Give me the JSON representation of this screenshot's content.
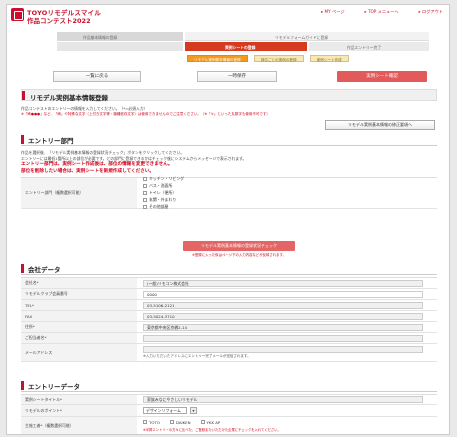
{
  "header": {
    "logo_line1": "TOYOリモデルスマイル",
    "logo_line2": "作品コンテスト2022",
    "nav": [
      "MY ページ",
      "TOP メニューへ",
      "ログアウト"
    ]
  },
  "steps": {
    "top_left": "作品基本情報の登録",
    "top_right": "リモデルフォームガイドに登録",
    "mid": [
      "",
      "実例シートの登録",
      "作品エントリー完了"
    ],
    "sub": [
      "リモデル実例基本情報の登録",
      "部位ごとの実例の登録",
      "実例シート作成"
    ],
    "sub_active": 0
  },
  "actions": {
    "back": "一覧に戻る",
    "save": "一時保存",
    "confirm": "実例シート確認"
  },
  "section1": {
    "title": "リモデル実例基本情報登録",
    "desc": "作品コンテストのエントリーの情報を入力してください。（*=必須入力）",
    "note": "※「㈱●●●」など、「㈱」や特殊な文字（上付き文字等・機種依存文字）は使用できませんのでご注意ください。（※「①」といった丸数字も使用不可です）",
    "rules_button": "リモデル実例基本情報の修正要項へ"
  },
  "section2": {
    "title": "エントリー部門",
    "desc1": "作品を選択後、「リモデル実例基本情報の登録状況チェック」ボタンをクリックしてください。",
    "desc2": "エントリーには最低1箇所以上の部位が必要です。どの部門に登録できるかはチェック後にシステムからメッセージで表示されます。",
    "warn1": "エントリー部門は、実例シート作成後は、部位の情報を変更できません。",
    "warn2": "部位を削除したい場合は、実例シートを新規作成してください。",
    "row_label": "エントリー部門（複数選択可能）",
    "options": [
      "キッチン・リビング",
      "バス・洗面所",
      "トイレ（便所）",
      "玄関・外まわり",
      "その他部屋"
    ]
  },
  "check_button": "リモデル実例基本情報の登録状況チェック",
  "check_note": "※登録に入った後はページ下の入力内容などが反映されます。",
  "section3": {
    "title": "会社データ",
    "rows": [
      {
        "label": "会社名*",
        "value": "(ー般)リモコン株式会社"
      },
      {
        "label": "リモデルクラブ会員番号",
        "value": "0000"
      },
      {
        "label": "TEL*",
        "value": "03-5106-2121"
      },
      {
        "label": "FAX",
        "value": "03-5024-3710"
      },
      {
        "label": "住所*",
        "value": "東京都中央区京橋2-14"
      },
      {
        "label": "ご担当者名*",
        "value": ""
      },
      {
        "label": "メールアドレス",
        "value": "",
        "note": "※入力いただいたアドレスにエントリー完了メールが送信されます。"
      }
    ]
  },
  "section4": {
    "title": "エントリーデータ",
    "rows": [
      {
        "label": "実例シートタイトル*",
        "value": "家族みなにやさしいリモデル"
      },
      {
        "label": "リモデルのポイント*",
        "select": "デザインリフォーム"
      },
      {
        "label": "主施工者*（複数選択可能）",
        "checks": [
          "TOTO",
          "DAIKEN",
          "YKK AP"
        ],
        "note": "※半掲エントリーの方々に比べた、ご登録またいただけた企業にチェックを入れてください。"
      }
    ]
  }
}
